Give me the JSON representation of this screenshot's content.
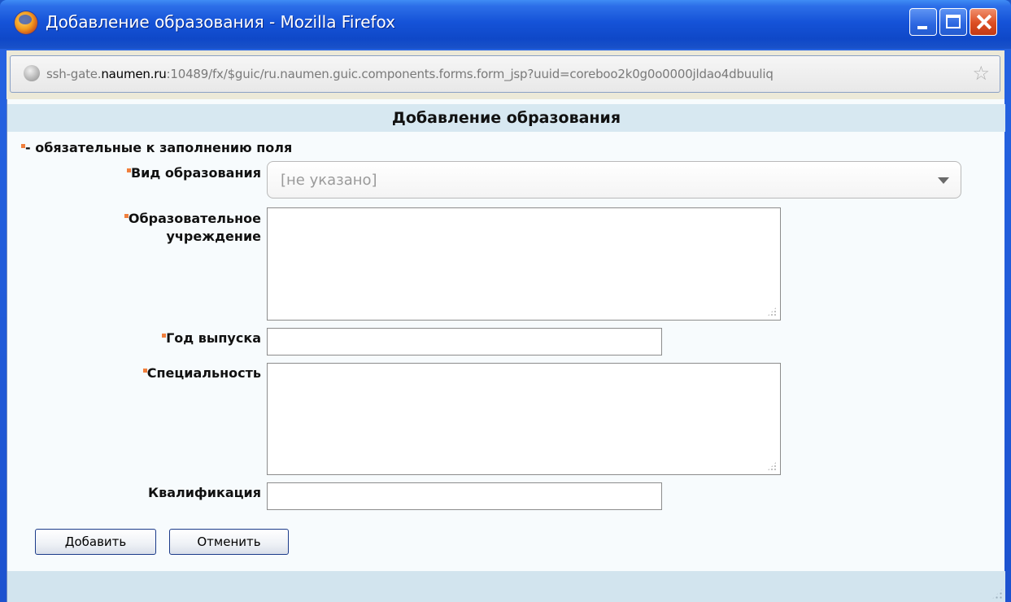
{
  "window": {
    "title": "Добавление образования - Mozilla Firefox",
    "minimize_icon": "minimize-icon",
    "maximize_icon": "maximize-icon",
    "close_icon": "close-icon"
  },
  "address_bar": {
    "url_host_prefix": "ssh-gate.",
    "url_domain": "naumen.ru",
    "url_rest": ":10489/fx/$guic/ru.naumen.guic.components.forms.form_jsp?uuid=coreboo2k0g0o0000jldao4dbuuliq",
    "site_icon": "globe-icon",
    "bookmark_icon": "star-icon"
  },
  "form": {
    "title": "Добавление образования",
    "legend": "- обязательные к заполнению поля",
    "accent_color": "#f07f3d",
    "fields": {
      "education_type": {
        "label": "Вид образования",
        "value": "[не указано]",
        "required": true
      },
      "institution": {
        "label_line1": "Образовательное",
        "label_line2": "учреждение",
        "value": "",
        "required": true
      },
      "graduation_year": {
        "label": "Год выпуска",
        "value": "",
        "required": true
      },
      "specialty": {
        "label": "Специальность",
        "value": "",
        "required": true
      },
      "qualification": {
        "label": "Квалификация",
        "value": "",
        "required": false
      }
    },
    "buttons": {
      "add": "Добавить",
      "cancel": "Отменить"
    }
  }
}
